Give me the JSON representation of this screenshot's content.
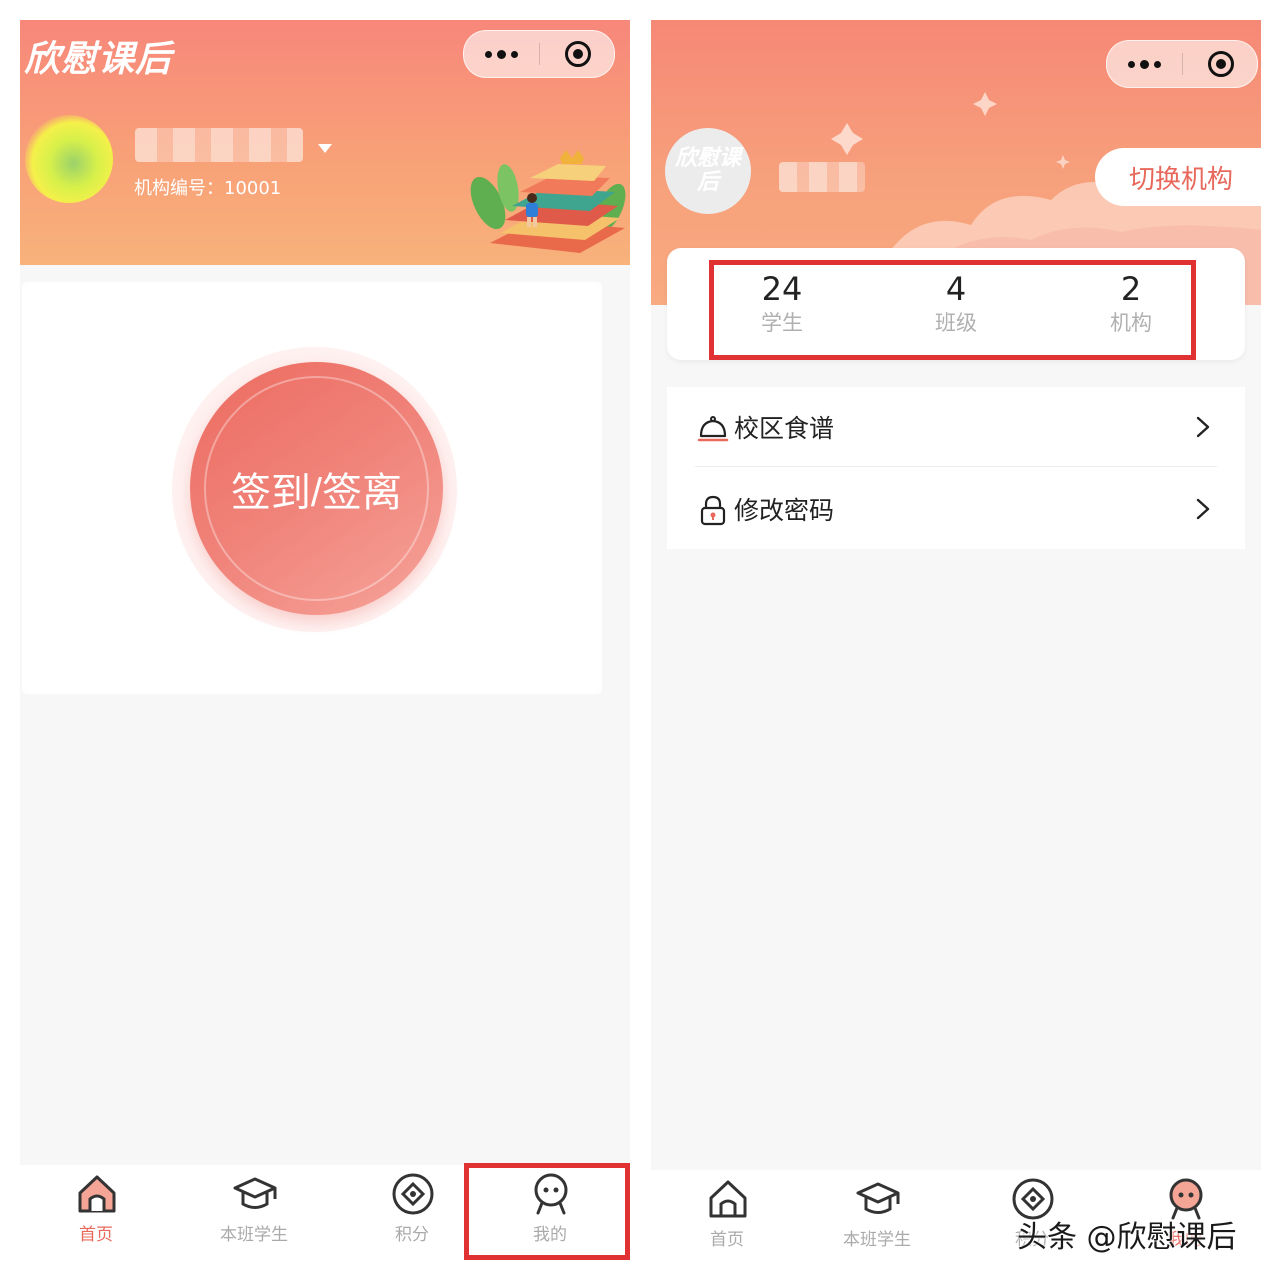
{
  "left": {
    "logo": "欣慰课后",
    "org_number": "机构编号：10001",
    "checkin_label": "签到/签离",
    "tabs": [
      {
        "label": "首页",
        "icon": "home-icon",
        "active": true
      },
      {
        "label": "本班学生",
        "icon": "graduation-cap-icon",
        "active": false
      },
      {
        "label": "积分",
        "icon": "points-coin-icon",
        "active": false
      },
      {
        "label": "我的",
        "icon": "profile-face-icon",
        "active": false
      }
    ]
  },
  "right": {
    "org_logo_text": "欣慰课后",
    "switch_org_label": "切换机构",
    "stats": [
      {
        "value": "24",
        "label": "学生"
      },
      {
        "value": "4",
        "label": "班级"
      },
      {
        "value": "2",
        "label": "机构"
      }
    ],
    "menu": [
      {
        "label": "校区食谱",
        "icon": "food-cloche-icon"
      },
      {
        "label": "修改密码",
        "icon": "lock-icon"
      }
    ],
    "tabs": [
      {
        "label": "首页",
        "icon": "home-icon"
      },
      {
        "label": "本班学生",
        "icon": "graduation-cap-icon"
      },
      {
        "label": "积分",
        "icon": "points-coin-icon"
      },
      {
        "label": "我的",
        "icon": "profile-face-icon"
      }
    ]
  },
  "watermark": "头条 @欣慰课后",
  "colors": {
    "accent": "#e8685b",
    "header_top": "#f7877a",
    "header_bottom": "#f8b27a",
    "highlight_box": "#e03232"
  }
}
